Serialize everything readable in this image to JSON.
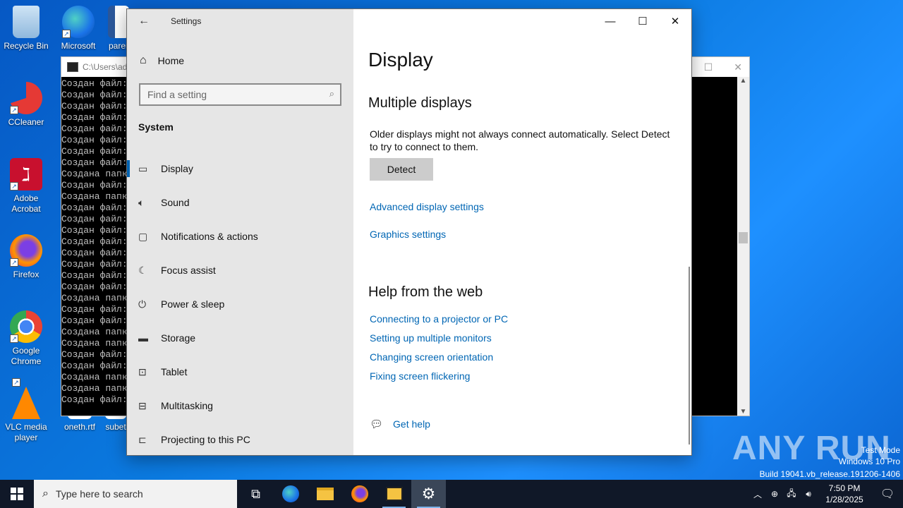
{
  "desktop": {
    "icons": [
      {
        "label": "Recycle Bin"
      },
      {
        "label": "Microsoft Edge"
      },
      {
        "label": "parer"
      },
      {
        "label": "CCleaner"
      },
      {
        "label": "Adobe Acrobat"
      },
      {
        "label": "Firefox"
      },
      {
        "label": "Google Chrome"
      },
      {
        "label": "VLC media player"
      },
      {
        "label": "oneth.rtf"
      },
      {
        "label": "subet"
      }
    ]
  },
  "console": {
    "title": "C:\\Users\\adm",
    "lines": [
      "Создан файл:",
      "Создан файл:",
      "Создан файл:",
      "Создан файл:",
      "Создан файл:",
      "Создан файл:",
      "Создан файл:",
      "Создан файл:",
      "Создана папк",
      "Создан файл:",
      "Создана папк",
      "Создан файл:",
      "Создан файл:",
      "Создан файл:",
      "Создан файл:",
      "Создан файл:",
      "Создан файл:",
      "Создан файл:",
      "Создан файл:",
      "Создана папк",
      "Создан файл:",
      "Создан файл:",
      "Создана папк",
      "Создана папк",
      "Создан файл:",
      "Создан файл:",
      "Создана папк",
      "Создана папк",
      "Создан файл:"
    ]
  },
  "settings": {
    "window_title": "Settings",
    "home_label": "Home",
    "search_placeholder": "Find a setting",
    "section": "System",
    "nav": [
      {
        "label": "Display",
        "icon": "monitor-icon",
        "active": true
      },
      {
        "label": "Sound",
        "icon": "speaker-icon"
      },
      {
        "label": "Notifications & actions",
        "icon": "notifications-icon"
      },
      {
        "label": "Focus assist",
        "icon": "moon-icon"
      },
      {
        "label": "Power & sleep",
        "icon": "power-icon"
      },
      {
        "label": "Storage",
        "icon": "storage-icon"
      },
      {
        "label": "Tablet",
        "icon": "tablet-icon"
      },
      {
        "label": "Multitasking",
        "icon": "multitasking-icon"
      },
      {
        "label": "Projecting to this PC",
        "icon": "projecting-icon"
      }
    ],
    "page_title": "Display",
    "multiple_displays_heading": "Multiple displays",
    "multiple_displays_desc": "Older displays might not always connect automatically. Select Detect to try to connect to them.",
    "detect_button": "Detect",
    "advanced_link": "Advanced display settings",
    "graphics_link": "Graphics settings",
    "help_heading": "Help from the web",
    "help_links": [
      "Connecting to a projector or PC",
      "Setting up multiple monitors",
      "Changing screen orientation",
      "Fixing screen flickering"
    ],
    "get_help": "Get help"
  },
  "watermark": {
    "brand": "ANY RUN",
    "line1": "Test Mode",
    "line2": "Windows 10 Pro",
    "line3": "Build 19041.vb_release.191206-1406"
  },
  "taskbar": {
    "search_placeholder": "Type here to search",
    "time": "7:50 PM",
    "date": "1/28/2025"
  },
  "colors": {
    "accent": "#0063b1",
    "link": "#0066b4",
    "sidebar_bg": "#e6e6e6",
    "taskbar_bg": "#101828"
  }
}
